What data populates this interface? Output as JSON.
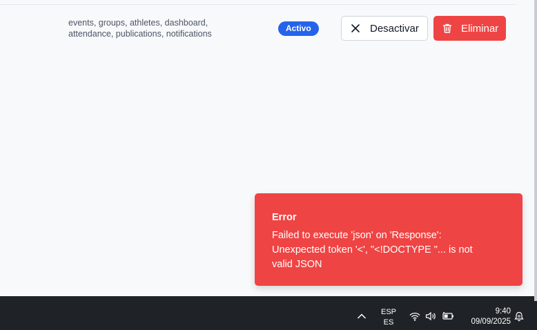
{
  "row": {
    "permissions_line1": "events, groups, athletes, dashboard,",
    "permissions_line2": "attendance, publications, notifications",
    "status_badge": "Activo",
    "deactivate_label": "Desactivar",
    "delete_label": "Eliminar"
  },
  "toast": {
    "title": "Error",
    "message": "Failed to execute 'json' on 'Response': Unexpected token '<', \"<!DOCTYPE \"... is not valid JSON"
  },
  "taskbar": {
    "lang_line1": "ESP",
    "lang_line2": "ES",
    "time": "9:40",
    "date": "09/09/2025",
    "icons": [
      "chevron-up-icon",
      "wifi-icon",
      "volume-icon",
      "battery-icon",
      "notification-bell-icon"
    ]
  },
  "colors": {
    "primary_blue": "#2563eb",
    "danger_red": "#ef4444",
    "background": "#f8f9fb",
    "taskbar": "#1f2328"
  }
}
